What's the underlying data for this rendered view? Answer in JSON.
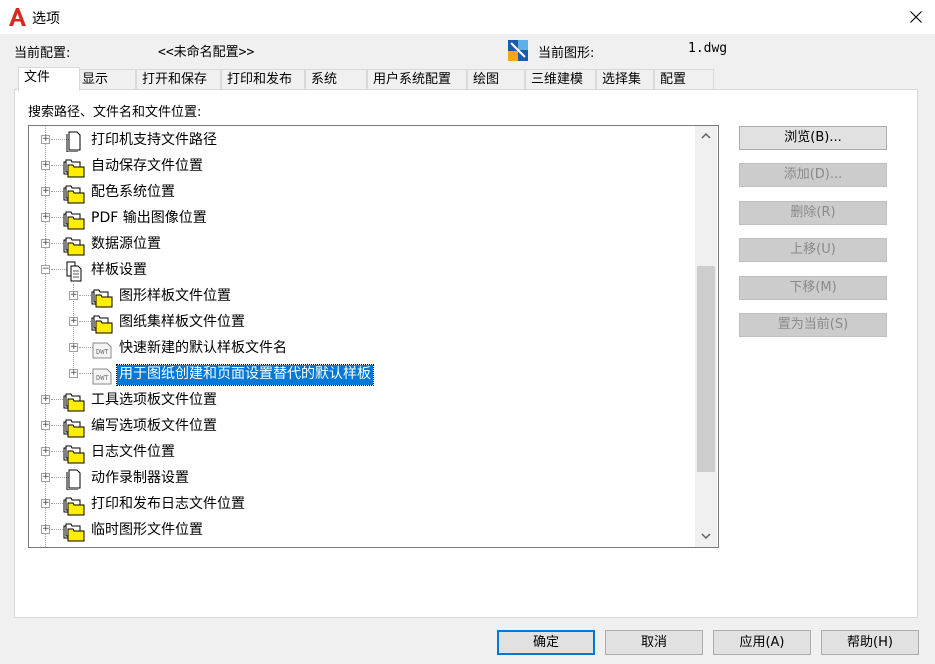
{
  "window": {
    "title": "选项",
    "close_icon": "close-icon"
  },
  "header": {
    "profile_label": "当前配置:",
    "profile_value": "<<未命名配置>>",
    "drawing_label": "当前图形:",
    "drawing_value": "1.dwg"
  },
  "tabs": [
    {
      "label": "文件",
      "active": true
    },
    {
      "label": "显示",
      "active": false
    },
    {
      "label": "打开和保存",
      "active": false
    },
    {
      "label": "打印和发布",
      "active": false
    },
    {
      "label": "系统",
      "active": false
    },
    {
      "label": "用户系统配置",
      "active": false
    },
    {
      "label": "绘图",
      "active": false
    },
    {
      "label": "三维建模",
      "active": false
    },
    {
      "label": "选择集",
      "active": false
    },
    {
      "label": "配置",
      "active": false
    }
  ],
  "search_label": "搜索路径、文件名和文件位置:",
  "tree": [
    {
      "label": "打印机支持文件路径",
      "icon": "file-icon",
      "level": 0,
      "expanded": false,
      "selected": false
    },
    {
      "label": "自动保存文件位置",
      "icon": "folder-icon",
      "level": 0,
      "expanded": false,
      "selected": false
    },
    {
      "label": "配色系统位置",
      "icon": "folder-icon",
      "level": 0,
      "expanded": false,
      "selected": false
    },
    {
      "label": "PDF 输出图像位置",
      "icon": "folder-icon",
      "level": 0,
      "expanded": false,
      "selected": false
    },
    {
      "label": "数据源位置",
      "icon": "folder-icon",
      "level": 0,
      "expanded": false,
      "selected": false
    },
    {
      "label": "样板设置",
      "icon": "documents-icon",
      "level": 0,
      "expanded": true,
      "selected": false
    },
    {
      "label": "图形样板文件位置",
      "icon": "folder-icon",
      "level": 1,
      "expanded": false,
      "selected": false
    },
    {
      "label": "图纸集样板文件位置",
      "icon": "folder-icon",
      "level": 1,
      "expanded": false,
      "selected": false
    },
    {
      "label": "快速新建的默认样板文件名",
      "icon": "dwt-file-icon",
      "level": 1,
      "expanded": false,
      "selected": false
    },
    {
      "label": "用于图纸创建和页面设置替代的默认样板",
      "icon": "dwt-file-icon",
      "level": 1,
      "expanded": false,
      "selected": true
    },
    {
      "label": "工具选项板文件位置",
      "icon": "folder-icon",
      "level": 0,
      "expanded": false,
      "selected": false
    },
    {
      "label": "编写选项板文件位置",
      "icon": "folder-icon",
      "level": 0,
      "expanded": false,
      "selected": false
    },
    {
      "label": "日志文件位置",
      "icon": "folder-icon",
      "level": 0,
      "expanded": false,
      "selected": false
    },
    {
      "label": "动作录制器设置",
      "icon": "file-icon",
      "level": 0,
      "expanded": false,
      "selected": false
    },
    {
      "label": "打印和发布日志文件位置",
      "icon": "folder-icon",
      "level": 0,
      "expanded": false,
      "selected": false
    },
    {
      "label": "临时图形文件位置",
      "icon": "folder-icon",
      "level": 0,
      "expanded": false,
      "selected": false
    }
  ],
  "side_buttons": {
    "browse": "浏览(B)...",
    "add": "添加(D)...",
    "remove": "删除(R)",
    "move_up": "上移(U)",
    "move_down": "下移(M)",
    "set_current": "置为当前(S)"
  },
  "bottom_buttons": {
    "ok": "确定",
    "cancel": "取消",
    "apply": "应用(A)",
    "help": "帮助(H)"
  },
  "colors": {
    "selection": "#0078d7",
    "folder_yellow": "#ffee00"
  }
}
